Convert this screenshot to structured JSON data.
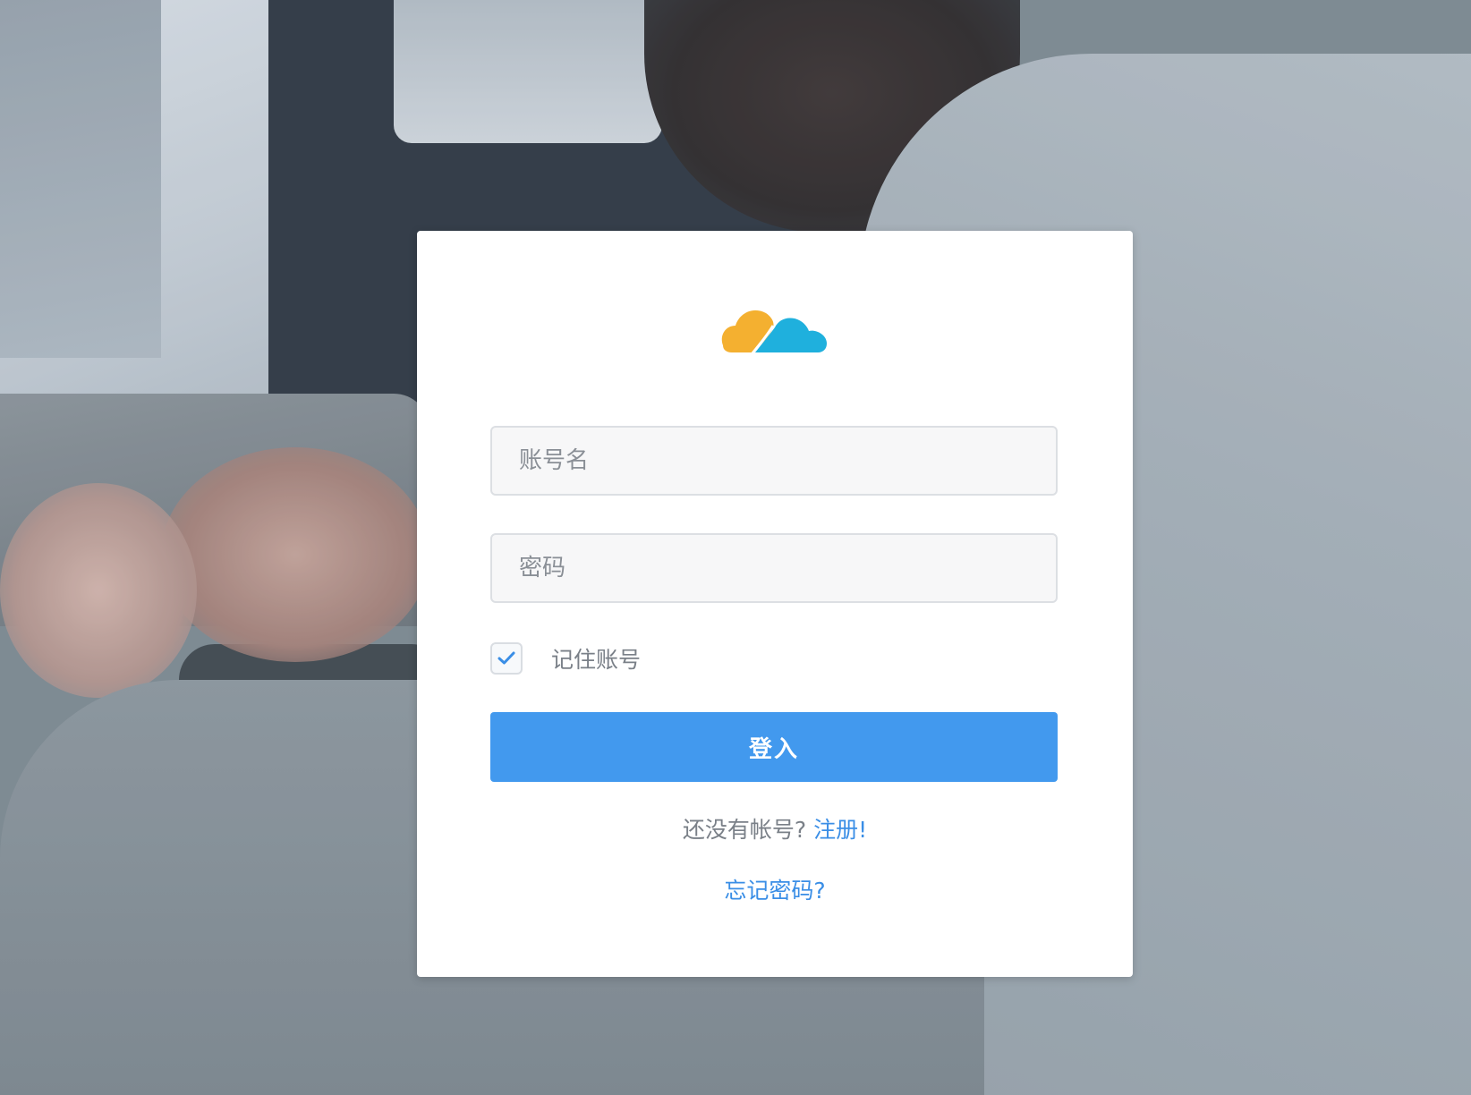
{
  "login": {
    "username_placeholder": "账号名",
    "password_placeholder": "密码",
    "remember_label": "记住账号",
    "remember_checked": true,
    "submit_label": "登入",
    "signup_prompt": "还没有帐号?",
    "signup_link": "注册!",
    "forgot_link": "忘记密码?"
  },
  "colors": {
    "primary": "#4299ee",
    "link": "#3a8ee6",
    "logo_yellow": "#f4b030",
    "logo_blue": "#1fb0dd"
  }
}
